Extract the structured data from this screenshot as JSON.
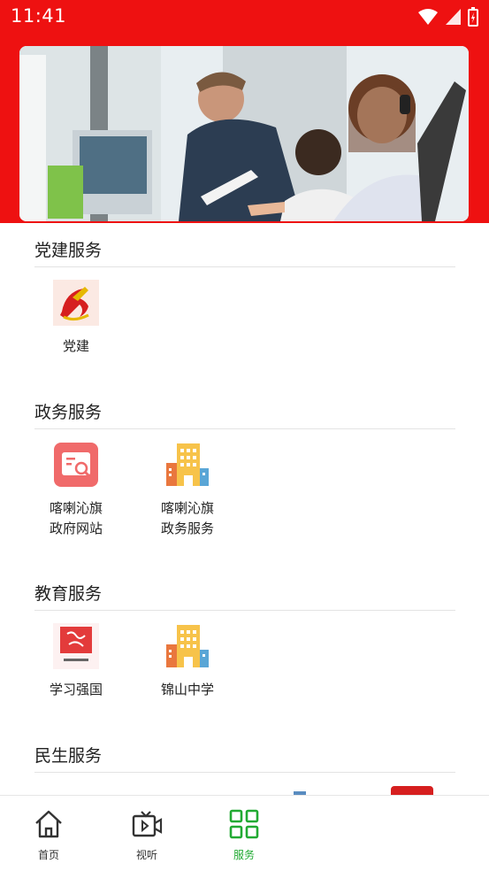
{
  "status_bar": {
    "time": "11:41"
  },
  "colors": {
    "brand_red": "#ee1111",
    "active_green": "#22aa33"
  },
  "sections": [
    {
      "title": "党建服务",
      "items": [
        {
          "label": "党建",
          "icon": "party-emblem-icon"
        }
      ]
    },
    {
      "title": "政务服务",
      "items": [
        {
          "label": "喀喇沁旗\n政府网站",
          "icon": "gov-website-icon"
        },
        {
          "label": "喀喇沁旗\n政务服务",
          "icon": "buildings-icon"
        }
      ]
    },
    {
      "title": "教育服务",
      "items": [
        {
          "label": "学习强国",
          "icon": "xuexi-qiangguo-icon"
        },
        {
          "label": "锦山中学",
          "icon": "buildings-icon"
        }
      ]
    },
    {
      "title": "民生服务",
      "items": []
    }
  ],
  "bottom_nav": [
    {
      "label": "首页",
      "icon": "home-icon",
      "active": false
    },
    {
      "label": "视听",
      "icon": "tv-icon",
      "active": false
    },
    {
      "label": "服务",
      "icon": "grid-icon",
      "active": true
    }
  ]
}
